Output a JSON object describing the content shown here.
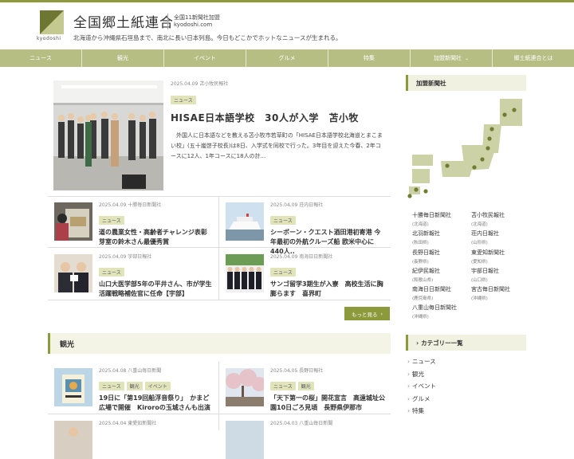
{
  "site": {
    "title": "全国郷土紙連合",
    "logo_text": "kyodoshi",
    "sub_line1": "全国11新聞社加盟",
    "sub_line2": "kyodoshi.com",
    "tagline": "北海道から沖縄県石垣島まで、南北に長い日本列島。今日もどこかでホットなニュースが生まれる。"
  },
  "nav": [
    "ニュース",
    "観光",
    "イベント",
    "グルメ",
    "特集",
    "加盟新聞社",
    "郷土紙連合とは"
  ],
  "featured": {
    "meta": "2025.04.09  苫小牧民報社",
    "tag": "ニュース",
    "title": "HISAE日本語学校　30人が入学　苫小牧",
    "body": "　外国人に日本語などを教える苫小牧市若草町の「HISAE日本語学校北海道とまこまい校」(五十嵐啓子校長)は8日、入学式を同校で行った。3年目を迎えた今春、2年コースに12人、1年コースに18人の計..."
  },
  "news": [
    {
      "meta": "2025.04.09  十勝毎日新聞社",
      "tag": "ニュース",
      "title": "道の農業女性・高齢者チャレンジ表彰　芽室の鈴木さん最優秀賞"
    },
    {
      "meta": "2025.04.09  荘内日報社",
      "tag": "ニュース",
      "title": "シーボーン・クエスト酒田港初寄港 今年最初の外航クルーズ船 欧米中心に440人.."
    },
    {
      "meta": "2025.04.09  宇部日報社",
      "tag": "ニュース",
      "title": "山口大医学部5年の平井さん、市が学生活躍戦略補佐官に任命【宇部】"
    },
    {
      "meta": "2025.04.09  南海日日新聞社",
      "tag": "ニュース",
      "title": "サンゴ留学3期生が入寮　高校生活に胸膨らます　喜界町"
    }
  ],
  "more_label": "もっと見る",
  "kanko": {
    "heading": "観光",
    "items": [
      {
        "meta": "2025.04.08  八重山毎日新聞",
        "tags": [
          "ニュース",
          "観光",
          "イベント"
        ],
        "title": "19日に「第19回船浮音祭り」　かまど広場で開催　Kiroroの玉城さんも出演"
      },
      {
        "meta": "2025.04.05  長野日報社",
        "tags": [
          "ニュース",
          "観光"
        ],
        "title": "「天下第一の桜」開花宣言　高遠城址公園10日ごろ見頃　長野県伊那市"
      },
      {
        "meta": "2025.04.04  東愛知新聞社",
        "tags": [],
        "title": ""
      },
      {
        "meta": "2025.04.03  八重山毎日新聞",
        "tags": [],
        "title": ""
      }
    ]
  },
  "sidebar": {
    "papers_heading": "加盟新聞社",
    "papers": [
      {
        "name": "十勝毎日新聞社",
        "loc": "(北海道)"
      },
      {
        "name": "苫小牧民報社",
        "loc": "(北海道)"
      },
      {
        "name": "北羽新報社",
        "loc": "(秋田県)"
      },
      {
        "name": "荘内日報社",
        "loc": "(山形県)"
      },
      {
        "name": "長野日報社",
        "loc": "(長野県)"
      },
      {
        "name": "東愛知新聞社",
        "loc": "(愛知県)"
      },
      {
        "name": "紀伊民報社",
        "loc": "(和歌山県)"
      },
      {
        "name": "宇部日報社",
        "loc": "(山口県)"
      },
      {
        "name": "南海日日新聞社",
        "loc": "(鹿児島県)"
      },
      {
        "name": "宮古毎日新聞社",
        "loc": "(沖縄県)"
      },
      {
        "name": "八重山毎日新聞社",
        "loc": "(沖縄県)"
      }
    ],
    "categories_heading": "カテゴリー一覧",
    "categories": [
      "ニュース",
      "観光",
      "イベント",
      "グルメ",
      "特集"
    ]
  },
  "colors": {
    "accent": "#8c9a3c",
    "nav_bg": "#b7be84",
    "tag_bg": "#e0e4b8",
    "map_fill": "#ccd1a6"
  }
}
